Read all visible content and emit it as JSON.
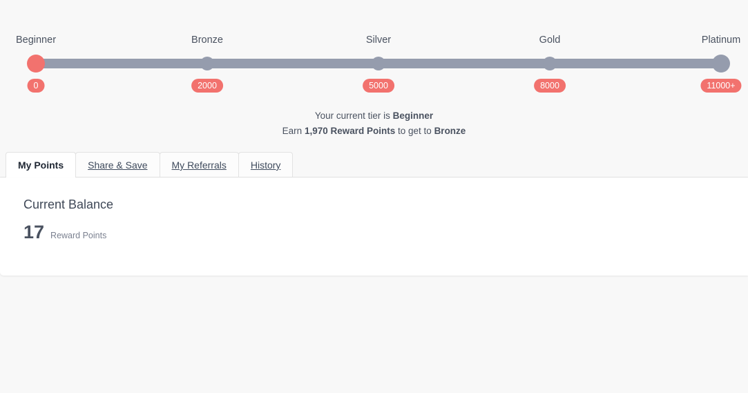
{
  "colors": {
    "accent": "#f2726e",
    "track": "#959cad",
    "text": "#4a5260",
    "page_bg": "#f8f8f8",
    "card_bg": "#ffffff"
  },
  "tier_progress": {
    "tiers": [
      {
        "label": "Beginner",
        "points": "0",
        "state": "active",
        "size": "big",
        "pos_pct": 0
      },
      {
        "label": "Bronze",
        "points": "2000",
        "state": "inactive",
        "size": "small",
        "pos_pct": 25
      },
      {
        "label": "Silver",
        "points": "5000",
        "state": "inactive",
        "size": "small",
        "pos_pct": 50
      },
      {
        "label": "Gold",
        "points": "8000",
        "state": "inactive",
        "size": "small",
        "pos_pct": 75
      },
      {
        "label": "Platinum",
        "points": "11000+",
        "state": "inactive",
        "size": "big",
        "pos_pct": 100
      }
    ]
  },
  "status": {
    "line1_prefix": "Your current tier is ",
    "line1_tier": "Beginner",
    "line2_prefix": "Earn ",
    "line2_points": "1,970 Reward Points",
    "line2_middle": " to get to ",
    "line2_tier": "Bronze"
  },
  "tabs": [
    {
      "label": "My Points",
      "active": true
    },
    {
      "label": "Share & Save",
      "active": false
    },
    {
      "label": "My Referrals",
      "active": false
    },
    {
      "label": "History",
      "active": false
    }
  ],
  "balance": {
    "title": "Current Balance",
    "value": "17",
    "unit": "Reward Points"
  }
}
